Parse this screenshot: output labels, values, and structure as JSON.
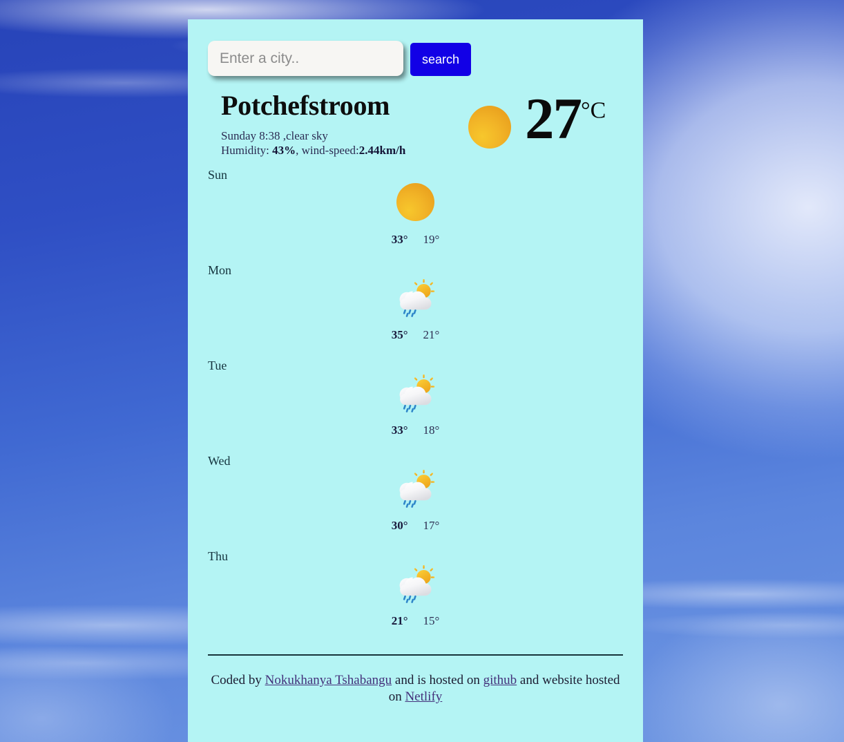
{
  "search": {
    "placeholder": "Enter a city..",
    "value": "",
    "button_label": "search"
  },
  "current": {
    "city": "Potchefstroom",
    "datetime_condition": "Sunday 8:38 ,clear sky",
    "humidity_label": "Humidity: ",
    "humidity_value": "43%",
    "wind_label": ", wind-speed:",
    "wind_value": "2.44km/h",
    "temperature": "27",
    "unit": "°C",
    "icon": "sun-icon"
  },
  "forecast": [
    {
      "day": "Sun",
      "icon": "sun-icon",
      "max": "33°",
      "min": "19°"
    },
    {
      "day": "Mon",
      "icon": "rain-sun-icon",
      "max": "35°",
      "min": "21°"
    },
    {
      "day": "Tue",
      "icon": "rain-sun-icon",
      "max": "33°",
      "min": "18°"
    },
    {
      "day": "Wed",
      "icon": "rain-sun-icon",
      "max": "30°",
      "min": "17°"
    },
    {
      "day": "Thu",
      "icon": "rain-sun-icon",
      "max": "21°",
      "min": "15°"
    }
  ],
  "footer": {
    "prefix": "Coded by ",
    "author_link": "Nokukhanya Tshabangu",
    "middle": " and is hosted on ",
    "repo_link": "github",
    "middle2": " and website hosted on ",
    "host_link": "Netlify"
  },
  "colors": {
    "card_background": "#b4f4f4",
    "search_button": "#1200e6",
    "sun": "#f2b427",
    "rain": "#2f7fc4",
    "link": "#43307a",
    "sky": "#3258cc"
  }
}
